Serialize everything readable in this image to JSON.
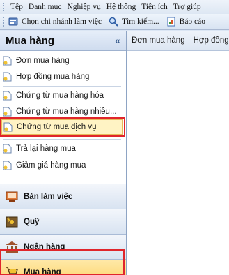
{
  "menubar": [
    "Tệp",
    "Danh mục",
    "Nghiệp vụ",
    "Hệ thống",
    "Tiện ích",
    "Trợ giúp"
  ],
  "toolbar": {
    "branch_label": "Chọn chi nhánh làm việc",
    "search_label": "Tìm kiếm...",
    "report_label": "Báo cáo"
  },
  "sidebar": {
    "title": "Mua hàng",
    "collapse": "«",
    "items": [
      "Đơn mua hàng",
      "Hợp đồng mua hàng",
      "Chứng từ mua hàng hóa",
      "Chứng từ mua hàng nhiều...",
      "Chứng từ mua dịch vụ",
      "Trả lại hàng mua",
      "Giảm giá hàng mua"
    ],
    "selected_index": 4,
    "groups": [
      "Bàn làm việc",
      "Quỹ",
      "Ngân hàng",
      "Mua hàng"
    ],
    "active_group": "Mua hàng"
  },
  "content": {
    "tabs": [
      "Đơn mua hàng",
      "Hợp đồng"
    ]
  },
  "colors": {
    "highlight_border": "#e0252b",
    "selected_bg": "#fff3c4",
    "active_group_bg": "#fcd36b"
  }
}
